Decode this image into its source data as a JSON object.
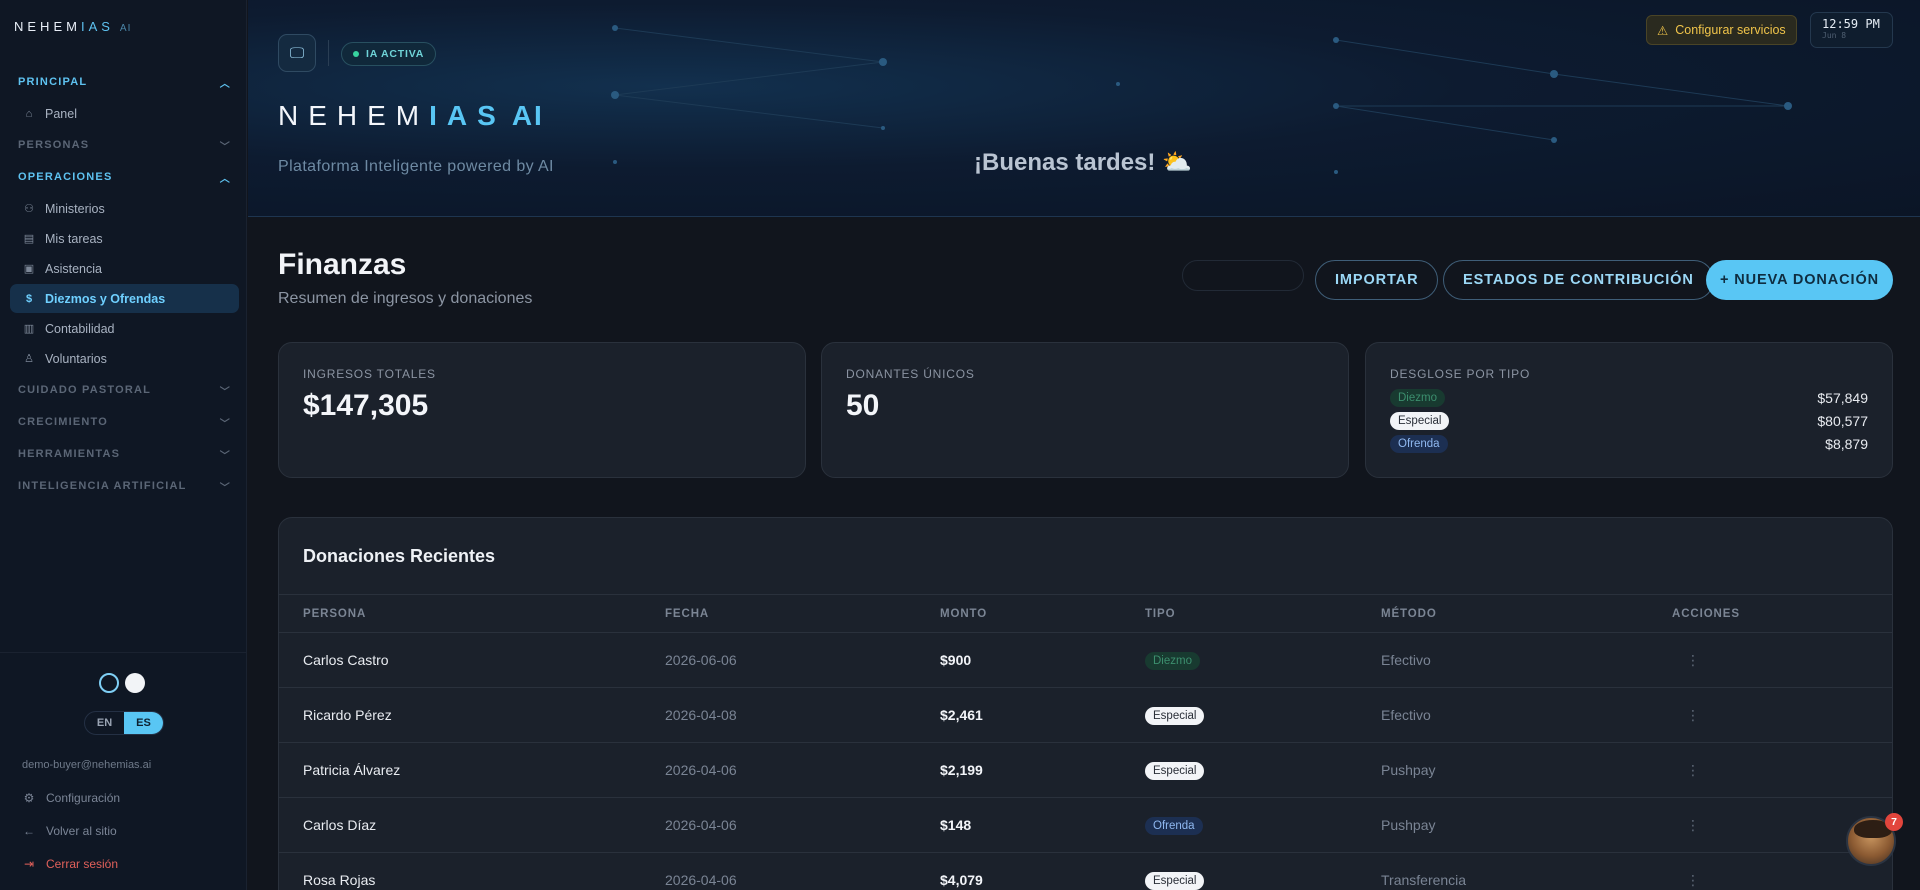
{
  "sidebar": {
    "brand": {
      "prefix": "NEHEM",
      "highlight": "IAS",
      "suffix": "AI"
    },
    "sections": [
      {
        "label": "PRINCIPAL",
        "items": [
          {
            "label": "Panel",
            "icon": "home-icon"
          }
        ]
      },
      {
        "label": "PERSONAS"
      },
      {
        "label": "OPERACIONES",
        "items": [
          {
            "label": "Ministerios",
            "icon": "users-icon"
          },
          {
            "label": "Mis tareas",
            "icon": "clipboard-icon"
          },
          {
            "label": "Asistencia",
            "icon": "clipboard-check-icon"
          },
          {
            "label": "Diezmos y Ofrendas",
            "icon": "dollar-circle-icon"
          },
          {
            "label": "Contabilidad",
            "icon": "ledger-icon"
          },
          {
            "label": "Voluntarios",
            "icon": "volunteer-icon"
          }
        ]
      },
      {
        "label": "CUIDADO PASTORAL"
      },
      {
        "label": "CRECIMIENTO"
      },
      {
        "label": "HERRAMIENTAS"
      },
      {
        "label": "INTELIGENCIA ARTIFICIAL"
      }
    ],
    "lang": {
      "en": "EN",
      "es": "ES"
    },
    "user_email": "demo-buyer@nehemias.ai",
    "links": {
      "settings": "Configuración",
      "back": "Volver al sitio",
      "logout": "Cerrar sesión"
    }
  },
  "hero": {
    "badge": "IA ACTIVA",
    "logo": {
      "prefix": "NEHEM",
      "highlight": "IAS",
      "suffix": "AI"
    },
    "subtitle": "Plataforma Inteligente powered by AI",
    "greeting": "¡Buenas tardes! ⛅",
    "config_button": "Configurar servicios",
    "clock_time": "12:59 PM",
    "clock_date": "Jun 8"
  },
  "page": {
    "title": "Finanzas",
    "subtitle": "Resumen de ingresos y donaciones",
    "buttons": {
      "import": "IMPORTAR",
      "statements": "ESTADOS DE CONTRIBUCIÓN",
      "new_donation": "+ NUEVA DONACIÓN"
    }
  },
  "stats": {
    "total_income": {
      "label": "INGRESOS TOTALES",
      "value": "$147,305"
    },
    "unique_donors": {
      "label": "DONANTES ÚNICOS",
      "value": "50"
    },
    "breakdown": {
      "label": "DESGLOSE POR TIPO",
      "rows": [
        {
          "type": "Diezmo",
          "value": "$57,849"
        },
        {
          "type": "Especial",
          "value": "$80,577"
        },
        {
          "type": "Ofrenda",
          "value": "$8,879"
        }
      ]
    }
  },
  "donations": {
    "title": "Donaciones Recientes",
    "columns": [
      "PERSONA",
      "FECHA",
      "MONTO",
      "TIPO",
      "MÉTODO",
      "ACCIONES"
    ],
    "rows": [
      {
        "person": "Carlos Castro",
        "date": "2026-06-06",
        "amount": "$900",
        "type": "Diezmo",
        "method": "Efectivo"
      },
      {
        "person": "Ricardo Pérez",
        "date": "2026-04-08",
        "amount": "$2,461",
        "type": "Especial",
        "method": "Efectivo"
      },
      {
        "person": "Patricia Álvarez",
        "date": "2026-04-06",
        "amount": "$2,199",
        "type": "Especial",
        "method": "Pushpay"
      },
      {
        "person": "Carlos Díaz",
        "date": "2026-04-06",
        "amount": "$148",
        "type": "Ofrenda",
        "method": "Pushpay"
      },
      {
        "person": "Rosa Rojas",
        "date": "2026-04-06",
        "amount": "$4,079",
        "type": "Especial",
        "method": "Transferencia"
      }
    ],
    "actions_glyph": "⋮"
  },
  "chat": {
    "notification_count": "7"
  },
  "colors": {
    "accent": "#59c6f4",
    "warning": "#f0c44a",
    "danger": "#e0605a",
    "success": "#38d39f"
  }
}
